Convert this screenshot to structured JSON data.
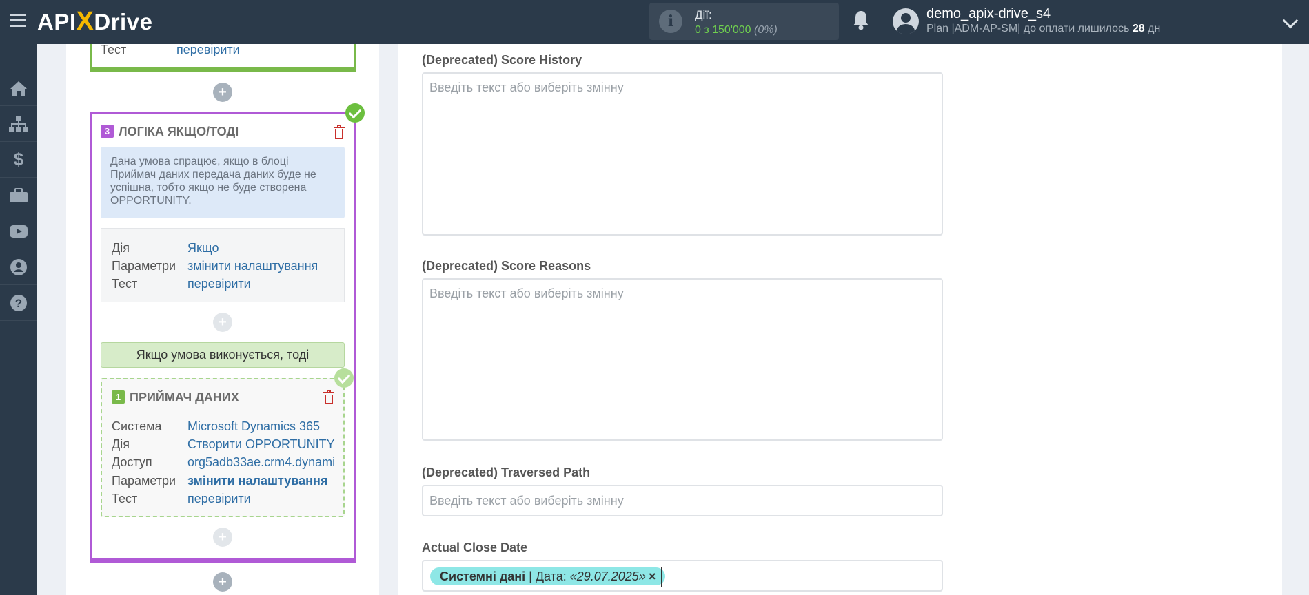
{
  "header": {
    "logo_api": "API",
    "logo_x": "X",
    "logo_drive": "Drive",
    "actions_label": "Дії:",
    "actions_value": "0 з 150'000",
    "actions_percent": "(0%)",
    "user_name": "demo_apix-drive_s4",
    "user_plan_prefix": "Plan |ADM-AP-SM| до оплати лишилось",
    "user_plan_days": "28",
    "user_plan_suffix": "дн"
  },
  "nav": [
    "home-icon",
    "sitemap-icon",
    "dollar-icon",
    "briefcase-icon",
    "youtube-icon",
    "user-icon",
    "help-icon"
  ],
  "top_card": {
    "test_key": "Тест",
    "test_value": "перевірити"
  },
  "logic_block": {
    "number": "3",
    "title": "ЛОГІКА ЯКЩО/ТОДІ",
    "info": "Дана умова спрацює, якщо в блоці Приймач даних передача даних буде не успішна, тобто якщо не буде створена OPPORTUNITY.",
    "rows": [
      {
        "key": "Дія",
        "value": "Якщо"
      },
      {
        "key": "Параметри",
        "value": "змінити налаштування"
      },
      {
        "key": "Тест",
        "value": "перевірити"
      }
    ],
    "condition_bar": "Якщо умова виконується, тоді"
  },
  "receiver_block": {
    "number": "1",
    "title": "ПРИЙМАЧ ДАНИХ",
    "rows": [
      {
        "key": "Система",
        "value": "Microsoft Dynamics 365"
      },
      {
        "key": "Дія",
        "value": "Створити OPPORTUNITY"
      },
      {
        "key": "Доступ",
        "value": "org5adb33ae.crm4.dynami"
      },
      {
        "key": "Параметри",
        "value": "змінити налаштування"
      },
      {
        "key": "Тест",
        "value": "перевірити"
      }
    ]
  },
  "form": {
    "fields": [
      {
        "label": "(Deprecated) Score History",
        "placeholder": "Введіть текст або виберіть змінну"
      },
      {
        "label": "(Deprecated) Score Reasons",
        "placeholder": "Введіть текст або виберіть змінну"
      },
      {
        "label": "(Deprecated) Traversed Path",
        "placeholder": "Введіть текст або виберіть змінну"
      },
      {
        "label": "Actual Close Date",
        "placeholder": ""
      }
    ],
    "tag": {
      "source": "Системні дані",
      "separator": " | Дата: ",
      "value": "«29.07.2025»",
      "remove": "×"
    }
  },
  "colors": {
    "header_bg": "#2b3a4a",
    "logic_border": "#b05ad6",
    "success": "#6cbf3f",
    "link": "#2f6ea5",
    "tag_bg": "#8ee7e6",
    "delete": "#c9302c"
  }
}
